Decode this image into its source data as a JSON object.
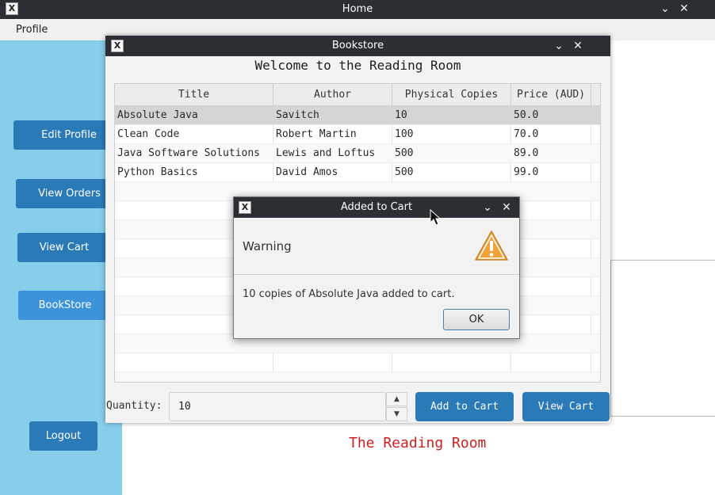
{
  "home_window": {
    "title": "Home",
    "menu": [
      "Profile"
    ],
    "sidebar_buttons": [
      "Edit Profile",
      "View Orders",
      "View Cart",
      "BookStore",
      "Logout"
    ],
    "footer_title": "The Reading Room"
  },
  "bookstore_window": {
    "title": "Bookstore",
    "heading": "Welcome to the Reading Room",
    "columns": [
      "Title",
      "Author",
      "Physical Copies",
      "Price (AUD)"
    ],
    "rows": [
      {
        "title": "Absolute Java",
        "author": "Savitch",
        "copies": "10",
        "price": "50.0"
      },
      {
        "title": "Clean Code",
        "author": "Robert Martin",
        "copies": "100",
        "price": "70.0"
      },
      {
        "title": "Java Software Solutions",
        "author": "Lewis and Loftus",
        "copies": "500",
        "price": "89.0"
      },
      {
        "title": "Python Basics",
        "author": "David Amos",
        "copies": "500",
        "price": "99.0"
      }
    ],
    "quantity_label": "Quantity:",
    "quantity_value": "10",
    "add_to_cart_label": "Add to Cart",
    "view_cart_label": "View Cart"
  },
  "dialog": {
    "title": "Added to Cart",
    "header": "Warning",
    "message": "10 copies of Absolute Java added to cart.",
    "ok_label": "OK",
    "icon": "warning-triangle-icon"
  },
  "colors": {
    "sidebar": "#87ceeb",
    "button": "#2b7ab8",
    "titlebar": "#2b2e33",
    "footer_text": "#d11f1f"
  }
}
